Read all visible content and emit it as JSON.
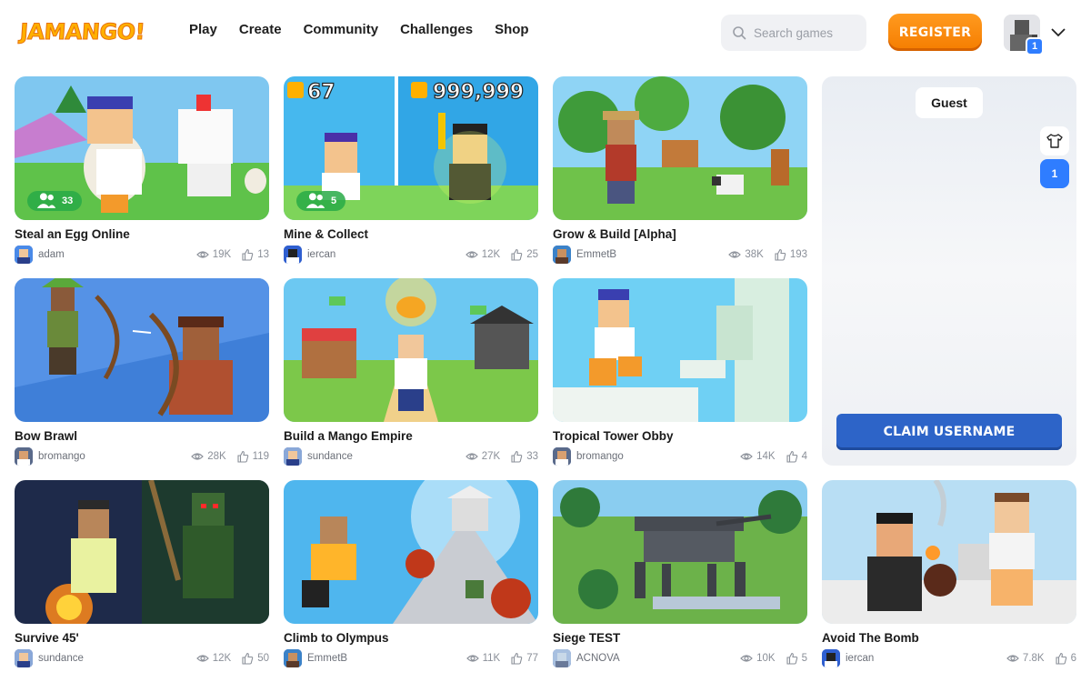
{
  "brand": {
    "logo_text": "JAMANGO!"
  },
  "nav": {
    "items": [
      "Play",
      "Create",
      "Community",
      "Challenges",
      "Shop"
    ]
  },
  "search": {
    "placeholder": "Search games"
  },
  "header": {
    "register_label": "REGISTER",
    "avatar_badge": "1"
  },
  "panel": {
    "guest_label": "Guest",
    "side_number": "1",
    "claim_label": "CLAIM USERNAME"
  },
  "games": [
    {
      "title": "Steal an Egg Online",
      "author": "adam",
      "views": "19K",
      "likes": "13",
      "players": "33",
      "overlay": ""
    },
    {
      "title": "Mine & Collect",
      "author": "iercan",
      "views": "12K",
      "likes": "25",
      "players": "5",
      "overlay_left": "67",
      "overlay_right": "999,999"
    },
    {
      "title": "Grow & Build [Alpha]",
      "author": "EmmetB",
      "views": "38K",
      "likes": "193"
    },
    {
      "title": "Bow Brawl",
      "author": "bromango",
      "views": "28K",
      "likes": "119"
    },
    {
      "title": "Build a Mango Empire",
      "author": "sundance",
      "views": "27K",
      "likes": "33"
    },
    {
      "title": "Tropical Tower Obby",
      "author": "bromango",
      "views": "14K",
      "likes": "4"
    },
    {
      "title": "Survive 45'",
      "author": "sundance",
      "views": "12K",
      "likes": "50"
    },
    {
      "title": "Climb to Olympus",
      "author": "EmmetB",
      "views": "11K",
      "likes": "77"
    },
    {
      "title": "Siege TEST",
      "author": "ACNOVA",
      "views": "10K",
      "likes": "5"
    },
    {
      "title": "Avoid The Bomb",
      "author": "iercan",
      "views": "7.8K",
      "likes": "6"
    }
  ],
  "colors": {
    "accent_orange": "#f57d00",
    "accent_blue": "#2d64c8",
    "badge_blue": "#2f7dff",
    "players_green": "#28aa46"
  }
}
